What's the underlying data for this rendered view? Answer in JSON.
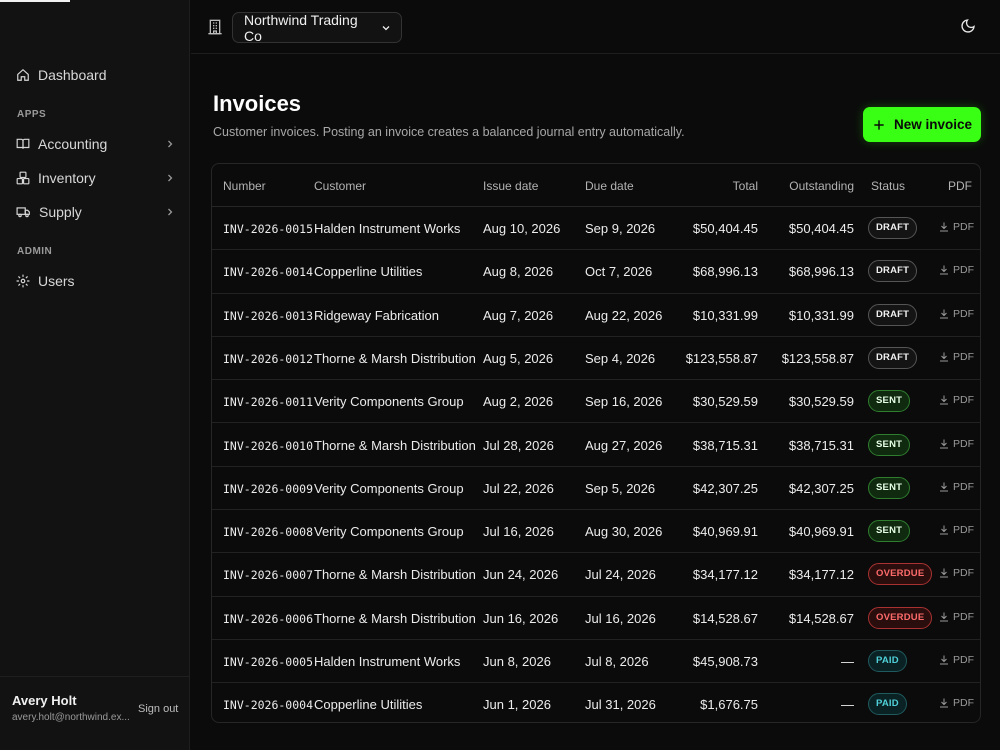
{
  "sidebar": {
    "dashboard": "Dashboard",
    "apps_heading": "APPS",
    "accounting": "Accounting",
    "inventory": "Inventory",
    "supply": "Supply",
    "admin_heading": "ADMIN",
    "users": "Users",
    "user_name": "Avery Holt",
    "user_email": "avery.holt@northwind.ex...",
    "sign_out": "Sign out"
  },
  "topbar": {
    "org_name": "Northwind Trading Co"
  },
  "page": {
    "title": "Invoices",
    "description": "Customer invoices. Posting an invoice creates a balanced journal entry automatically.",
    "new_button": "New invoice"
  },
  "table": {
    "headers": {
      "number": "Number",
      "customer": "Customer",
      "issue_date": "Issue date",
      "due_date": "Due date",
      "total": "Total",
      "outstanding": "Outstanding",
      "status": "Status",
      "pdf": "PDF"
    },
    "pdf_label": "PDF",
    "rows": [
      {
        "number": "INV-2026-0015",
        "customer": "Halden Instrument Works",
        "issue": "Aug 10, 2026",
        "due": "Sep 9, 2026",
        "total": "$50,404.45",
        "outstanding": "$50,404.45",
        "status": "DRAFT",
        "status_kind": "draft"
      },
      {
        "number": "INV-2026-0014",
        "customer": "Copperline Utilities",
        "issue": "Aug 8, 2026",
        "due": "Oct 7, 2026",
        "total": "$68,996.13",
        "outstanding": "$68,996.13",
        "status": "DRAFT",
        "status_kind": "draft"
      },
      {
        "number": "INV-2026-0013",
        "customer": "Ridgeway Fabrication",
        "issue": "Aug 7, 2026",
        "due": "Aug 22, 2026",
        "total": "$10,331.99",
        "outstanding": "$10,331.99",
        "status": "DRAFT",
        "status_kind": "draft"
      },
      {
        "number": "INV-2026-0012",
        "customer": "Thorne & Marsh Distribution",
        "issue": "Aug 5, 2026",
        "due": "Sep 4, 2026",
        "total": "$123,558.87",
        "outstanding": "$123,558.87",
        "status": "DRAFT",
        "status_kind": "draft"
      },
      {
        "number": "INV-2026-0011",
        "customer": "Verity Components Group",
        "issue": "Aug 2, 2026",
        "due": "Sep 16, 2026",
        "total": "$30,529.59",
        "outstanding": "$30,529.59",
        "status": "SENT",
        "status_kind": "sent"
      },
      {
        "number": "INV-2026-0010",
        "customer": "Thorne & Marsh Distribution",
        "issue": "Jul 28, 2026",
        "due": "Aug 27, 2026",
        "total": "$38,715.31",
        "outstanding": "$38,715.31",
        "status": "SENT",
        "status_kind": "sent"
      },
      {
        "number": "INV-2026-0009",
        "customer": "Verity Components Group",
        "issue": "Jul 22, 2026",
        "due": "Sep 5, 2026",
        "total": "$42,307.25",
        "outstanding": "$42,307.25",
        "status": "SENT",
        "status_kind": "sent"
      },
      {
        "number": "INV-2026-0008",
        "customer": "Verity Components Group",
        "issue": "Jul 16, 2026",
        "due": "Aug 30, 2026",
        "total": "$40,969.91",
        "outstanding": "$40,969.91",
        "status": "SENT",
        "status_kind": "sent"
      },
      {
        "number": "INV-2026-0007",
        "customer": "Thorne & Marsh Distribution",
        "issue": "Jun 24, 2026",
        "due": "Jul 24, 2026",
        "total": "$34,177.12",
        "outstanding": "$34,177.12",
        "status": "OVERDUE",
        "status_kind": "overdue"
      },
      {
        "number": "INV-2026-0006",
        "customer": "Thorne & Marsh Distribution",
        "issue": "Jun 16, 2026",
        "due": "Jul 16, 2026",
        "total": "$14,528.67",
        "outstanding": "$14,528.67",
        "status": "OVERDUE",
        "status_kind": "overdue"
      },
      {
        "number": "INV-2026-0005",
        "customer": "Halden Instrument Works",
        "issue": "Jun 8, 2026",
        "due": "Jul 8, 2026",
        "total": "$45,908.73",
        "outstanding": "—",
        "status": "PAID",
        "status_kind": "paid"
      },
      {
        "number": "INV-2026-0004",
        "customer": "Copperline Utilities",
        "issue": "Jun 1, 2026",
        "due": "Jul 31, 2026",
        "total": "$1,676.75",
        "outstanding": "—",
        "status": "PAID",
        "status_kind": "paid"
      }
    ]
  },
  "colors": {
    "accent": "#39ff14",
    "background": "#0b0b0b",
    "sidebar": "#121212"
  }
}
